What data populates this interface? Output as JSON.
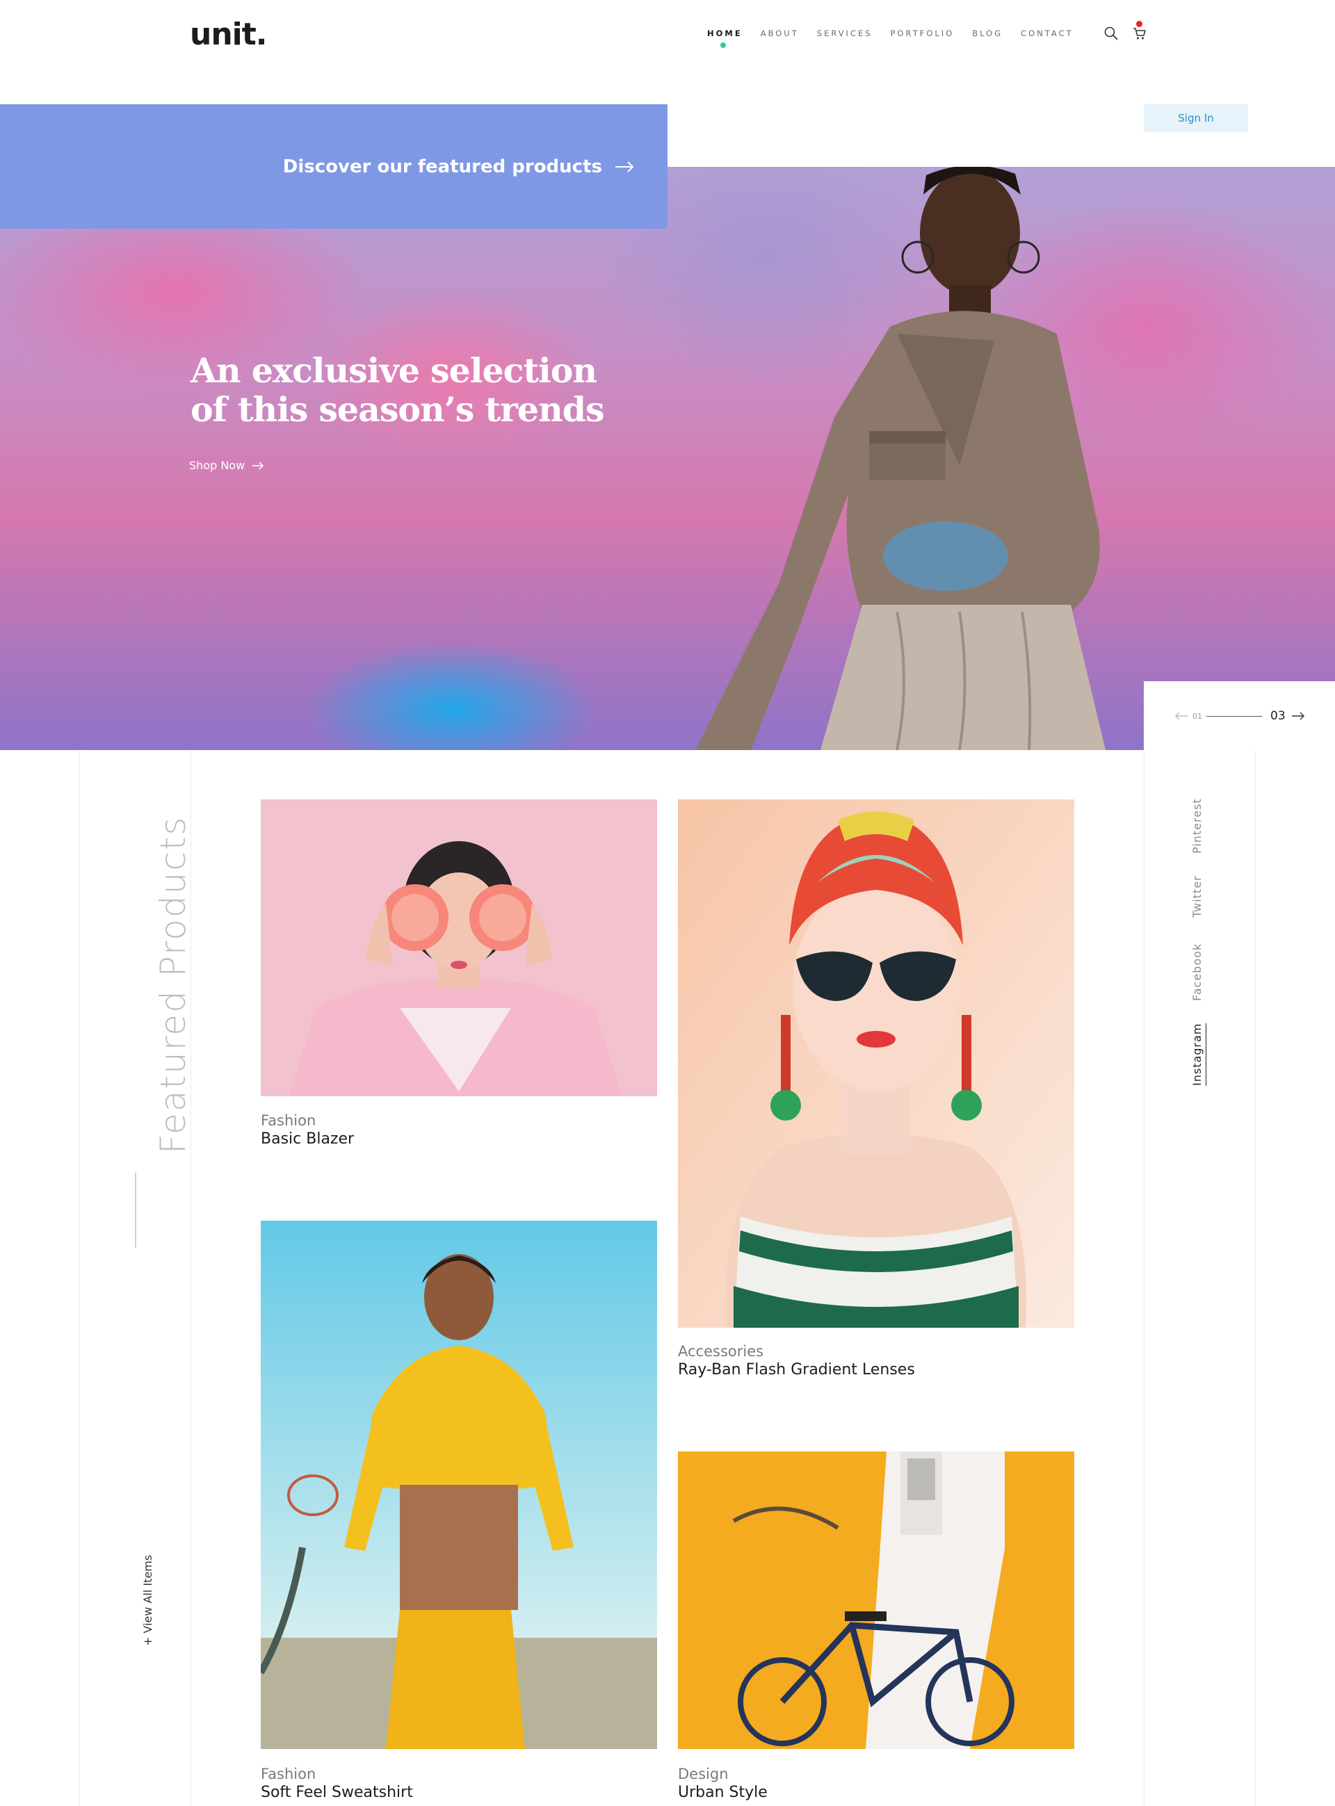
{
  "header": {
    "logo": "unit.",
    "nav": [
      "HOME",
      "ABOUT",
      "SERVICES",
      "PORTFOLIO",
      "BLOG",
      "CONTACT"
    ],
    "active_nav": "HOME",
    "accent_color": "#2ec9a7",
    "cart_badge_color": "#e8241c"
  },
  "banner": {
    "text": "Discover our featured products",
    "color": "#7f98e6"
  },
  "auth": {
    "sign_in": "Sign In"
  },
  "hero": {
    "title_line1": "An exclusive selection",
    "title_line2": "of this season’s trends",
    "cta": "Shop Now"
  },
  "slider": {
    "current": "01",
    "total": "03"
  },
  "featured": {
    "title": "Featured Products",
    "view_all": "+ View All Items",
    "products": [
      {
        "category": "Fashion",
        "name": "Basic Blazer"
      },
      {
        "category": "Accessories",
        "name": "Ray-Ban Flash Gradient Lenses"
      },
      {
        "category": "Fashion",
        "name": "Soft Feel Sweatshirt"
      },
      {
        "category": "Design",
        "name": "Urban Style"
      }
    ]
  },
  "social": [
    "Pinterest",
    "Twitter",
    "Facebook",
    "Instagram"
  ],
  "social_active": "Instagram"
}
